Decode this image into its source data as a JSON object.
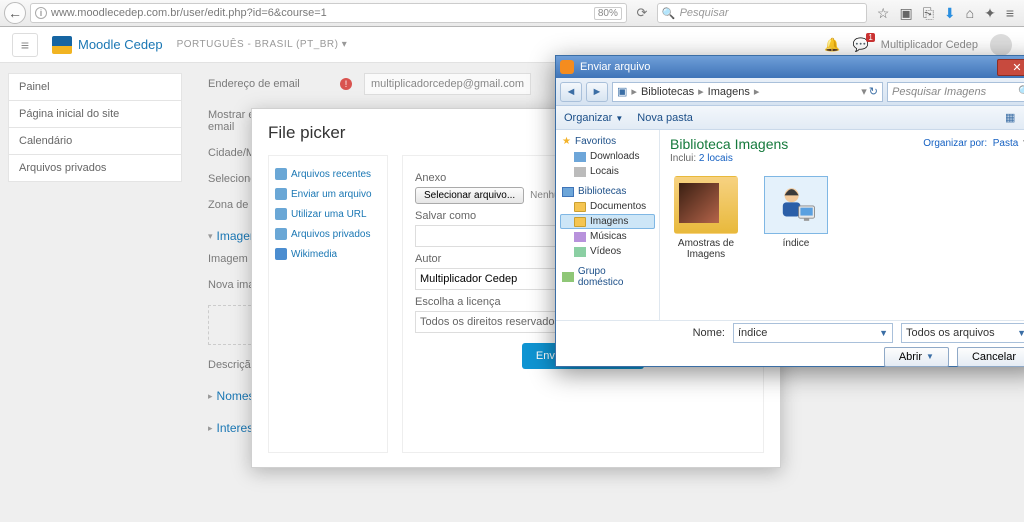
{
  "browser": {
    "url": "www.moodlecedep.com.br/user/edit.php?id=6&course=1",
    "zoom": "80%",
    "search_placeholder": "Pesquisar"
  },
  "header": {
    "brand": "Moodle Cedep",
    "lang": "PORTUGUÊS - BRASIL (PT_BR) ▾",
    "notif_count": "1",
    "username": "Multiplicador Cedep"
  },
  "sidebar": {
    "items": [
      "Painel",
      "Página inicial do site",
      "Calendário",
      "Arquivos privados"
    ]
  },
  "form": {
    "email_lbl": "Endereço de email",
    "email_val": "multiplicadorcedep@gmail.com",
    "show_email_lbl": "Mostrar endereço de email",
    "city_lbl": "Cidade/Município",
    "select_lbl": "Selecione um país",
    "tz_lbl": "Zona de fuso horário",
    "img_section": "Imagem do usuário",
    "img_current": "Imagem atual",
    "img_new": "Nova imagem",
    "desc_lbl": "Descrição",
    "names_section": "Nomes adicionais",
    "interests_section": "Interesses"
  },
  "picker": {
    "title": "File picker",
    "repos": [
      "Arquivos recentes",
      "Enviar um arquivo",
      "Utilizar uma URL",
      "Arquivos privados",
      "Wikimedia"
    ],
    "attach_lbl": "Anexo",
    "choose_btn": "Selecionar arquivo...",
    "no_file": "Nenhum arquivo",
    "save_lbl": "Salvar como",
    "author_lbl": "Autor",
    "author_val": "Multiplicador Cedep",
    "license_lbl": "Escolha a licença",
    "license_val": "Todos os direitos reservados",
    "send_btn": "Enviar este arquivo"
  },
  "win": {
    "title": "Enviar arquivo",
    "crumbs": [
      "Bibliotecas",
      "Imagens"
    ],
    "search_ph": "Pesquisar Imagens",
    "tool_org": "Organizar",
    "tool_new": "Nova pasta",
    "tree": {
      "fav": "Favoritos",
      "fav_items": [
        "Downloads",
        "Locais"
      ],
      "lib": "Bibliotecas",
      "lib_items": [
        "Documentos",
        "Imagens",
        "Músicas",
        "Vídeos"
      ],
      "group": "Grupo doméstico"
    },
    "files_h": "Biblioteca Imagens",
    "files_sub_pre": "Inclui:",
    "files_sub_link": "2 locais",
    "org_lbl": "Organizar por:",
    "org_val": "Pasta",
    "thumbs": [
      {
        "label": "Amostras de Imagens"
      },
      {
        "label": "índice"
      }
    ],
    "name_lbl": "Nome:",
    "name_val": "índice",
    "filter": "Todos os arquivos",
    "open": "Abrir",
    "cancel": "Cancelar"
  }
}
